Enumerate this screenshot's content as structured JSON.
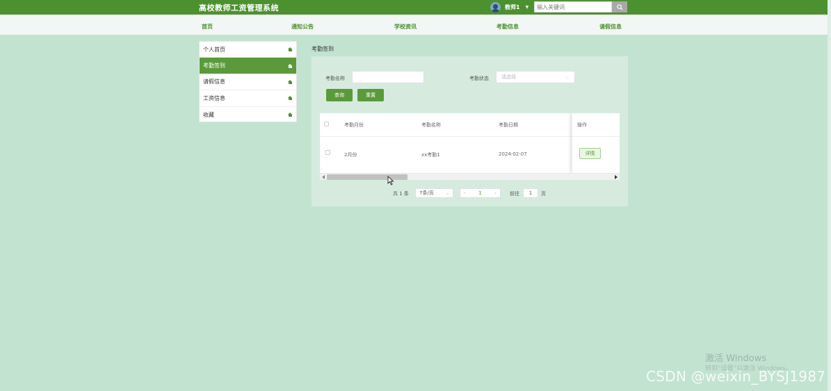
{
  "header": {
    "title": "高校教师工资管理系统",
    "user": "教师1",
    "search_placeholder": "输入关键词"
  },
  "nav": [
    "首页",
    "通知公告",
    "学校资讯",
    "考勤信息",
    "请假信息"
  ],
  "sidebar": {
    "items": [
      {
        "label": "个人首页"
      },
      {
        "label": "考勤签到"
      },
      {
        "label": "请假信息"
      },
      {
        "label": "工资信息"
      },
      {
        "label": "收藏"
      }
    ],
    "active_index": 1
  },
  "breadcrumb": "考勤签到",
  "filters": {
    "name_label": "考勤名称",
    "name_value": "",
    "status_label": "考勤状态",
    "status_placeholder": "请选择",
    "query_button": "查询",
    "reset_button": "重置"
  },
  "table": {
    "headers": [
      "考勤月份",
      "考勤名称",
      "考勤日期",
      "操作"
    ],
    "rows": [
      {
        "month": "2月份",
        "name": "xx考勤1",
        "date": "2024-02-07",
        "action": "详情"
      }
    ]
  },
  "pagination": {
    "total": "共 1 条",
    "page_size": "7条/页",
    "current_page": "1",
    "goto_label": "前往",
    "goto_value": "1",
    "page_unit": "页"
  },
  "watermarks": {
    "windows": "激活 Windows",
    "windows_sub": "转到“设置”以激活 Windows。",
    "csdn": "CSDN @weixin_BYSJ1987"
  },
  "colors": {
    "brand_green": "#4c9130",
    "page_bg": "#c2e3d0",
    "panel_bg": "#d6ebde",
    "active_item": "#5a9a3a"
  }
}
